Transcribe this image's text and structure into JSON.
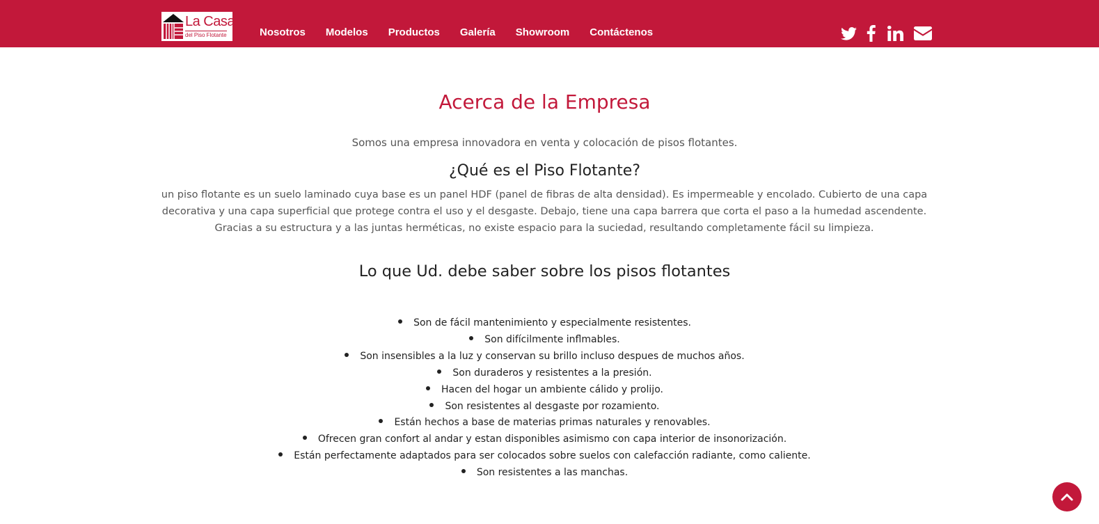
{
  "header": {
    "logo": {
      "line1": "La Casa",
      "line2": "del Piso Flotante"
    },
    "nav": [
      {
        "label": "Nosotros"
      },
      {
        "label": "Modelos"
      },
      {
        "label": "Productos"
      },
      {
        "label": "Galería"
      },
      {
        "label": "Showroom"
      },
      {
        "label": "Contáctenos"
      }
    ],
    "social": [
      "twitter-icon",
      "facebook-icon",
      "linkedin-icon",
      "envelope-icon"
    ]
  },
  "about": {
    "title": "Acerca de la Empresa",
    "intro": "Somos una empresa innovadora en venta y colocación de pisos flotantes.",
    "subtitle": "¿Qué es el Piso Flotante?",
    "definition": "un piso flotante es un suelo laminado cuya base es un panel HDF (panel de fibras de alta densidad). Es impermeable y encolado. Cubierto de una capa decorativa y una capa superficial que protege contra el uso y el desgaste. Debajo, tiene una capa barrera que corta el paso a la humedad ascendente. Gracias a su estructura y a las juntas herméticas, no existe espacio para la suciedad, resultando completamente fácil su limpieza."
  },
  "facts": {
    "title": "Lo que Ud. debe saber sobre los pisos flotantes",
    "items": [
      "Son de fácil mantenimiento y especialmente resistentes.",
      "Son difícilmente inflmables.",
      "Son insensibles a la luz y conservan su brillo incluso despues de muchos años.",
      "Son duraderos y resistentes a la presión.",
      "Hacen del hogar un ambiente cálido y prolijo.",
      "Son resistentes al desgaste por rozamiento.",
      "Están hechos a base de materias primas naturales y renovables.",
      "Ofrecen gran confort al andar y estan disponibles asimismo con capa interior de insonorización.",
      "Están perfectamente adaptados para ser colocados sobre suelos con calefacción radiante, como caliente.",
      "Son resistentes a las manchas."
    ]
  },
  "colors": {
    "brand": "#c2183a",
    "text": "#555555",
    "heading": "#222222"
  },
  "scroll_top": {
    "icon": "chevron-up-icon"
  }
}
